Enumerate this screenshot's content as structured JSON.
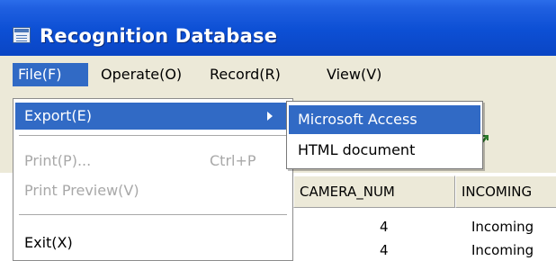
{
  "window": {
    "title": "Recognition Database"
  },
  "menubar": {
    "items": [
      {
        "label": "File(F)"
      },
      {
        "label": "Operate(O)"
      },
      {
        "label": "Record(R)"
      },
      {
        "label": "View(V)"
      }
    ]
  },
  "file_menu": {
    "export": "Export(E)",
    "print": "Print(P)...",
    "print_shortcut": "Ctrl+P",
    "print_preview": "Print Preview(V)",
    "exit": "Exit(X)"
  },
  "export_submenu": {
    "items": [
      {
        "label": "Microsoft Access"
      },
      {
        "label": "HTML document"
      }
    ]
  },
  "grid": {
    "columns": [
      "CAMERA_NUM",
      "INCOMING"
    ],
    "rows": [
      {
        "camera_num": "4",
        "incoming": "Incoming"
      },
      {
        "camera_num": "4",
        "incoming": "Incoming"
      }
    ]
  },
  "colors": {
    "titlebar": "#0c4fd4",
    "highlight": "#316ac5",
    "menu_bg": "#ece9d8",
    "disabled_text": "#a8a8a8"
  },
  "icons": {
    "app": "table-icon",
    "toolbar": "tool-icon",
    "submenu_arrow": "chevron-right-icon"
  }
}
